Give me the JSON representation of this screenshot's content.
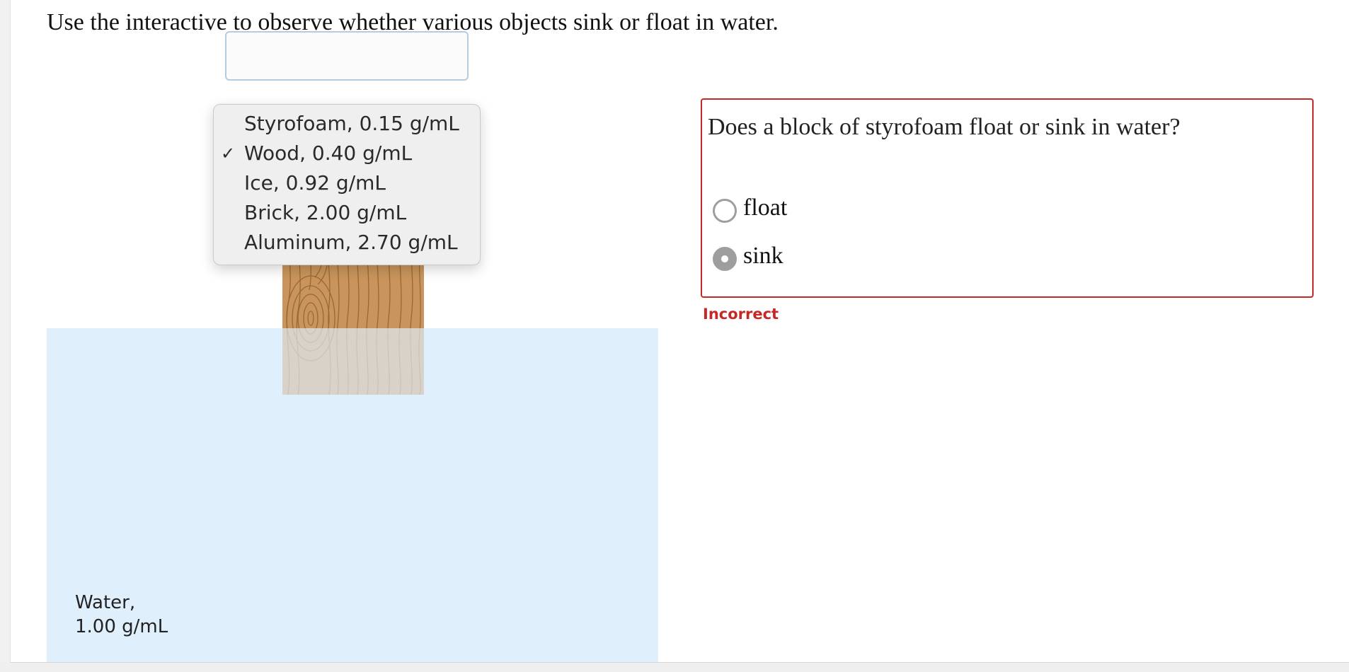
{
  "instructions": "Use the interactive to observe whether various objects sink or float in water.",
  "interactive": {
    "material_select": {
      "selected": "Wood, 0.40 g/mL",
      "check_mark": "✓",
      "options": [
        "Styrofoam, 0.15 g/mL",
        "Wood, 0.40 g/mL",
        "Ice, 0.92 g/mL",
        "Brick, 2.00 g/mL",
        "Aluminum, 2.70 g/mL"
      ]
    },
    "water_label_line1": "Water,",
    "water_label_line2": "1.00 g/mL",
    "block_material": "wood",
    "water_color": "#e0effc",
    "block_color": "#c9955c"
  },
  "question": {
    "text": "Does a block of styrofoam float or sink in water?",
    "choices": [
      {
        "label": "float",
        "selected": false
      },
      {
        "label": "sink",
        "selected": true
      }
    ],
    "feedback": "Incorrect",
    "feedback_color": "#c62828"
  }
}
